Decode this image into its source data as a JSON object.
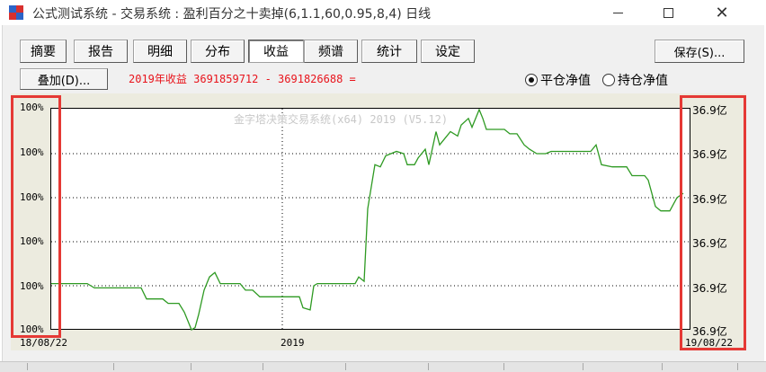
{
  "window": {
    "title": "公式测试系统 - 交易系统 : 盈利百分之十卖掉(6,1.1,60,0.95,8,4) 日线",
    "close_glyph": "✕"
  },
  "tabs": [
    {
      "label": "摘要",
      "active": false
    },
    {
      "label": "报告",
      "active": false
    },
    {
      "label": "明细",
      "active": false
    },
    {
      "label": "分布",
      "active": false
    },
    {
      "label": "收益",
      "active": true
    },
    {
      "label": "频谱",
      "active": false
    },
    {
      "label": "统计",
      "active": false
    },
    {
      "label": "设定",
      "active": false
    }
  ],
  "save_button": "保存(S)...",
  "overlay_button": "叠加(D)...",
  "profit_text": "2019年收益 3691859712 - 3691826688 =",
  "radios": [
    {
      "label": "平仓净值",
      "checked": true
    },
    {
      "label": "持仓净值",
      "checked": false
    }
  ],
  "watermark": "金字塔决策交易系统(x64) 2019 (V5.12)",
  "chart_data": {
    "type": "line",
    "left_axis_labels": [
      "100%",
      "100%",
      "100%",
      "100%",
      "100%",
      "100%"
    ],
    "right_axis_labels": [
      "36.9亿",
      "36.9亿",
      "36.9亿",
      "36.9亿",
      "36.9亿",
      "36.9亿"
    ],
    "x_labels": [
      "18/08/22",
      "2019",
      "19/08/22"
    ],
    "grid": "dotted",
    "line_color": "#2e9a22",
    "ylim": [
      0,
      100
    ],
    "series": [
      {
        "values": [
          [
            0,
            21
          ],
          [
            40,
            21
          ],
          [
            48,
            19
          ],
          [
            100,
            19
          ],
          [
            106,
            14
          ],
          [
            124,
            14
          ],
          [
            130,
            12
          ],
          [
            142,
            12
          ],
          [
            148,
            8
          ],
          [
            156,
            0
          ],
          [
            160,
            1
          ],
          [
            164,
            7
          ],
          [
            170,
            18
          ],
          [
            176,
            24
          ],
          [
            182,
            26
          ],
          [
            188,
            21
          ],
          [
            210,
            21
          ],
          [
            216,
            18
          ],
          [
            224,
            18
          ],
          [
            232,
            15
          ],
          [
            276,
            15
          ],
          [
            280,
            10
          ],
          [
            288,
            9
          ],
          [
            292,
            20
          ],
          [
            296,
            21
          ],
          [
            338,
            21
          ],
          [
            342,
            24
          ],
          [
            348,
            22
          ],
          [
            352,
            55
          ],
          [
            360,
            75
          ],
          [
            366,
            74
          ],
          [
            372,
            79
          ],
          [
            384,
            81
          ],
          [
            392,
            80
          ],
          [
            396,
            75
          ],
          [
            404,
            75
          ],
          [
            408,
            78
          ],
          [
            416,
            82
          ],
          [
            420,
            75
          ],
          [
            428,
            90
          ],
          [
            432,
            84
          ],
          [
            436,
            86
          ],
          [
            444,
            90
          ],
          [
            452,
            88
          ],
          [
            456,
            93
          ],
          [
            464,
            96
          ],
          [
            468,
            92
          ],
          [
            476,
            100
          ],
          [
            480,
            96
          ],
          [
            484,
            91
          ],
          [
            504,
            91
          ],
          [
            510,
            89
          ],
          [
            518,
            89
          ],
          [
            526,
            84
          ],
          [
            532,
            82
          ],
          [
            540,
            80
          ],
          [
            550,
            80
          ],
          [
            556,
            81
          ],
          [
            576,
            81
          ],
          [
            600,
            81
          ],
          [
            606,
            84
          ],
          [
            612,
            75
          ],
          [
            624,
            74
          ],
          [
            640,
            74
          ],
          [
            646,
            70
          ],
          [
            660,
            70
          ],
          [
            664,
            68
          ],
          [
            672,
            56
          ],
          [
            678,
            54
          ],
          [
            688,
            54
          ],
          [
            696,
            60
          ],
          [
            703,
            62
          ]
        ]
      }
    ]
  }
}
